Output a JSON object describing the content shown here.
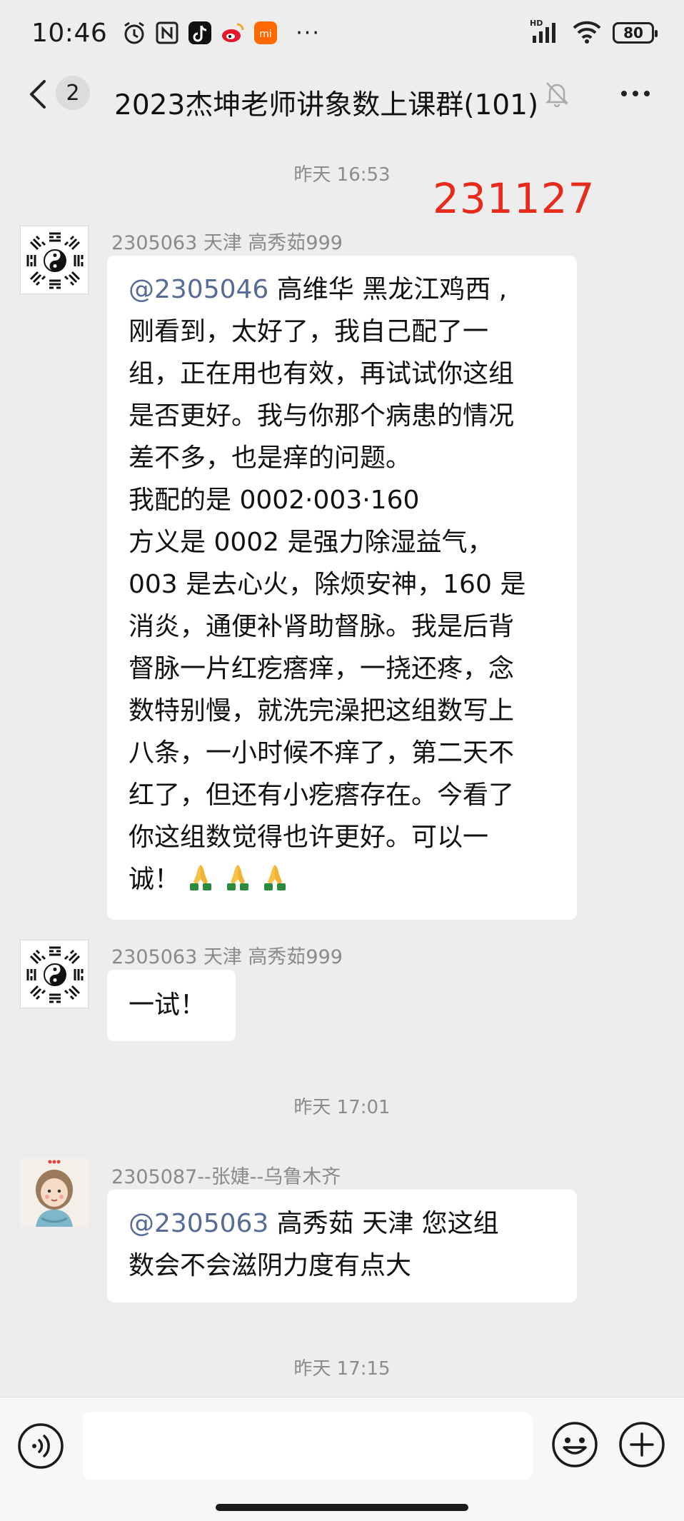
{
  "status_bar": {
    "time": "10:46",
    "more": "···",
    "battery": "80",
    "network": "HD"
  },
  "nav": {
    "unread_count": "2",
    "title": "2023杰坤老师讲象数上课群(101)"
  },
  "chat": {
    "timestamps": [
      "昨天 16:53",
      "昨天 17:01",
      "昨天 17:15"
    ],
    "annotation": "231127",
    "messages": [
      {
        "sender": "2305063  天津  高秀茹999",
        "mention": "@2305046",
        "lines": [
          "  高维华  黑龙江鸡西 ,",
          "刚看到，太好了，我自己配了一",
          "组，正在用也有效，再试试你这组",
          "是否更好。我与你那个病患的情况",
          "差不多，也是痒的问题。",
          "我配的是 0002·003·160",
          "方义是 0002 是强力除湿益气，",
          "003 是去心火，除烦安神，160 是",
          "消炎，通便补肾助督脉。我是后背",
          "督脉一片红疙瘩痒，一挠还疼，念",
          "数特别慢，就洗完澡把这组数写上",
          "八条，一小时候不痒了，第二天不",
          "红了，但还有小疙瘩存在。今看了",
          "你这组数觉得也许更好。可以一",
          "诚！"
        ]
      },
      {
        "sender": "2305063  天津  高秀茹999",
        "text": "一试！"
      },
      {
        "sender": "2305087--张婕--乌鲁木齐",
        "mention": "@2305063",
        "lines": [
          "  高秀茹  天津  您这组",
          "数会不会滋阴力度有点大"
        ]
      }
    ]
  },
  "colors": {
    "background": "#ededed",
    "bubble": "#ffffff",
    "mention": "#576b95",
    "annotation": "#e82a1a"
  },
  "icons": [
    "back-icon",
    "mute-icon",
    "more-icon",
    "voice-icon",
    "emoji-icon",
    "plus-icon",
    "yin-yang-bagua-icon",
    "folded-hands-icon"
  ]
}
